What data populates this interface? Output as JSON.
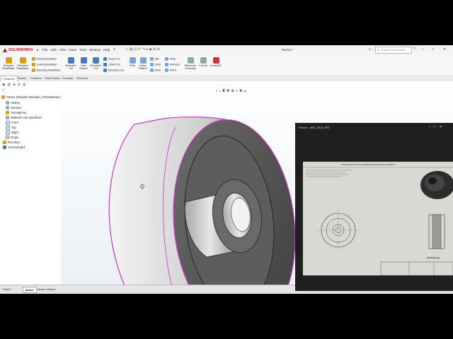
{
  "app": {
    "brand": "SOLIDWORKS",
    "document_title": "Part12 *",
    "search_placeholder": "Search Commands",
    "menus": [
      "File",
      "Edit",
      "View",
      "Insert",
      "Tools",
      "Window",
      "Help"
    ]
  },
  "ribbon": {
    "extruded_boss": "Extruded Boss/Base",
    "revolved_boss": "Revolved Boss/Base",
    "swept_boss": "Swept Boss/Base",
    "lofted_boss": "Lofted Boss/Base",
    "boundary_boss": "Boundary Boss/Base",
    "extruded_cut": "Extruded Cut",
    "hole_wizard": "Hole Wizard",
    "revolved_cut": "Revolved Cut",
    "swept_cut": "Swept Cut",
    "lofted_cut": "Lofted Cut",
    "boundary_cut": "Boundary Cut",
    "fillet": "Fillet",
    "linear_pattern": "Linear Pattern",
    "rib": "Rib",
    "draft": "Draft",
    "shell": "Shell",
    "wrap": "Wrap",
    "intersect": "Intersect",
    "mirror": "Mirror",
    "reference_geometry": "Reference Geometry",
    "curves": "Curves",
    "instant3d": "Instant3D"
  },
  "command_tabs": [
    "Features",
    "Sketch",
    "Surfaces",
    "Sheet Metal",
    "Evaluate",
    "SimXpert"
  ],
  "tree": {
    "part": "Part12 (Default<<Default>_PhotoWorks) Di",
    "items": [
      "History",
      "Sensors",
      "Annotations",
      "Material <not specified>",
      "Front",
      "Top",
      "Right",
      "Origin",
      "Revolve1",
      "Cut-Extrude1"
    ]
  },
  "bottom_tabs": [
    "Model",
    "Motion Study 1"
  ],
  "status": {
    "left": "Part12"
  },
  "photo": {
    "title": "Photos - IMG_8214.JPG",
    "paper_header": "PRODUCED BY AN AUTODESK EDUCATIONAL PRODUCT",
    "section_label": "SECTION B-B"
  },
  "colors": {
    "accent": "#c8102e",
    "edge": "#cc33cc",
    "ribbon_bg": "#f7f7f7"
  }
}
